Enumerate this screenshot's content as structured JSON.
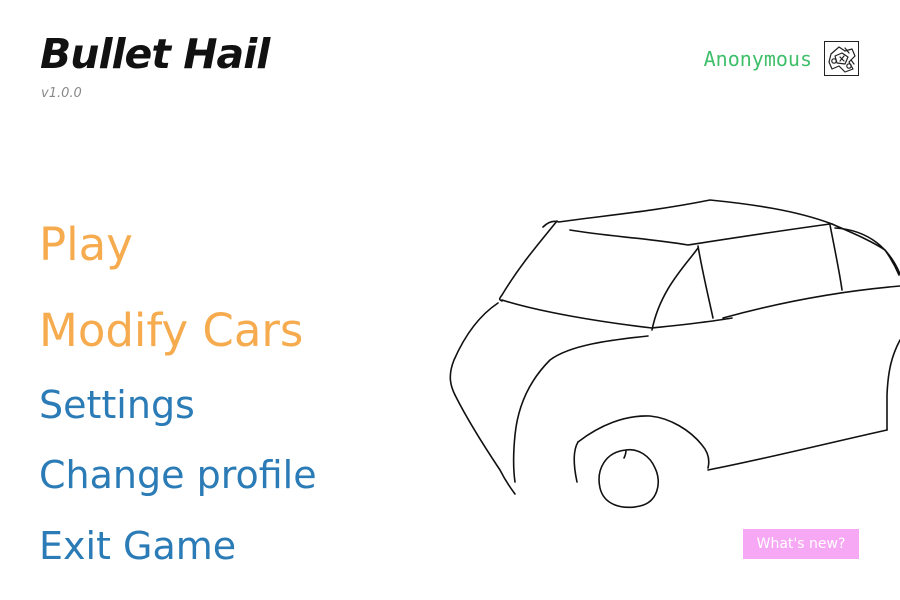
{
  "header": {
    "title": "Bullet Hail",
    "version": "v1.0.0"
  },
  "profile": {
    "name": "Anonymous",
    "avatar_icon": "doodle-avatar-icon"
  },
  "menu": {
    "items": [
      {
        "label": "Play",
        "style": "primary"
      },
      {
        "label": "Modify Cars",
        "style": "primary"
      },
      {
        "label": "Settings",
        "style": "secondary"
      },
      {
        "label": "Change profile",
        "style": "secondary"
      },
      {
        "label": "Exit Game",
        "style": "secondary"
      }
    ]
  },
  "preview": {
    "image_icon": "car-sketch-icon"
  },
  "whats_new": {
    "label": "What's new?"
  },
  "colors": {
    "primary_menu": "#f6ab4e",
    "secondary_menu": "#2a7bb6",
    "profile_name": "#3fbf6a",
    "whats_new_bg": "#f7a8f5"
  }
}
